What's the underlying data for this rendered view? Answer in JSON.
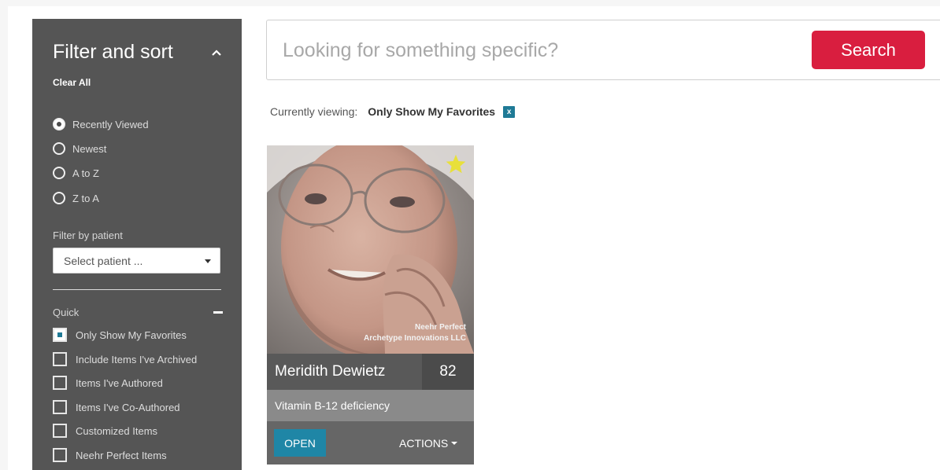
{
  "sidebar": {
    "title": "Filter and sort",
    "clear_all": "Clear All",
    "sort_options": [
      {
        "label": "Recently Viewed",
        "checked": true
      },
      {
        "label": "Newest",
        "checked": false
      },
      {
        "label": "A to Z",
        "checked": false
      },
      {
        "label": "Z to A",
        "checked": false
      }
    ],
    "filter_label": "Filter by patient",
    "patient_select": "Select patient ...",
    "quick_label": "Quick",
    "quick_options": [
      {
        "label": "Only Show My Favorites",
        "checked": true
      },
      {
        "label": "Include Items I've Archived",
        "checked": false
      },
      {
        "label": "Items I've Authored",
        "checked": false
      },
      {
        "label": "Items I've Co-Authored",
        "checked": false
      },
      {
        "label": "Customized Items",
        "checked": false
      },
      {
        "label": "Neehr Perfect Items",
        "checked": false
      }
    ]
  },
  "search": {
    "placeholder": "Looking for something specific?",
    "button": "Search"
  },
  "currently_viewing": {
    "label": "Currently viewing:",
    "value": "Only Show My Favorites",
    "remove": "x"
  },
  "card": {
    "credit_line1": "Neehr Perfect",
    "credit_line2": "Archetype Innovations LLC",
    "name": "Meridith Dewietz",
    "score": "82",
    "condition": "Vitamin B-12 deficiency",
    "open": "OPEN",
    "actions": "ACTIONS",
    "favorited": true
  },
  "colors": {
    "sidebar_bg": "#555555",
    "search_button": "#d91e3f",
    "accent_teal": "#1f86a6",
    "star": "#e8e03a"
  }
}
